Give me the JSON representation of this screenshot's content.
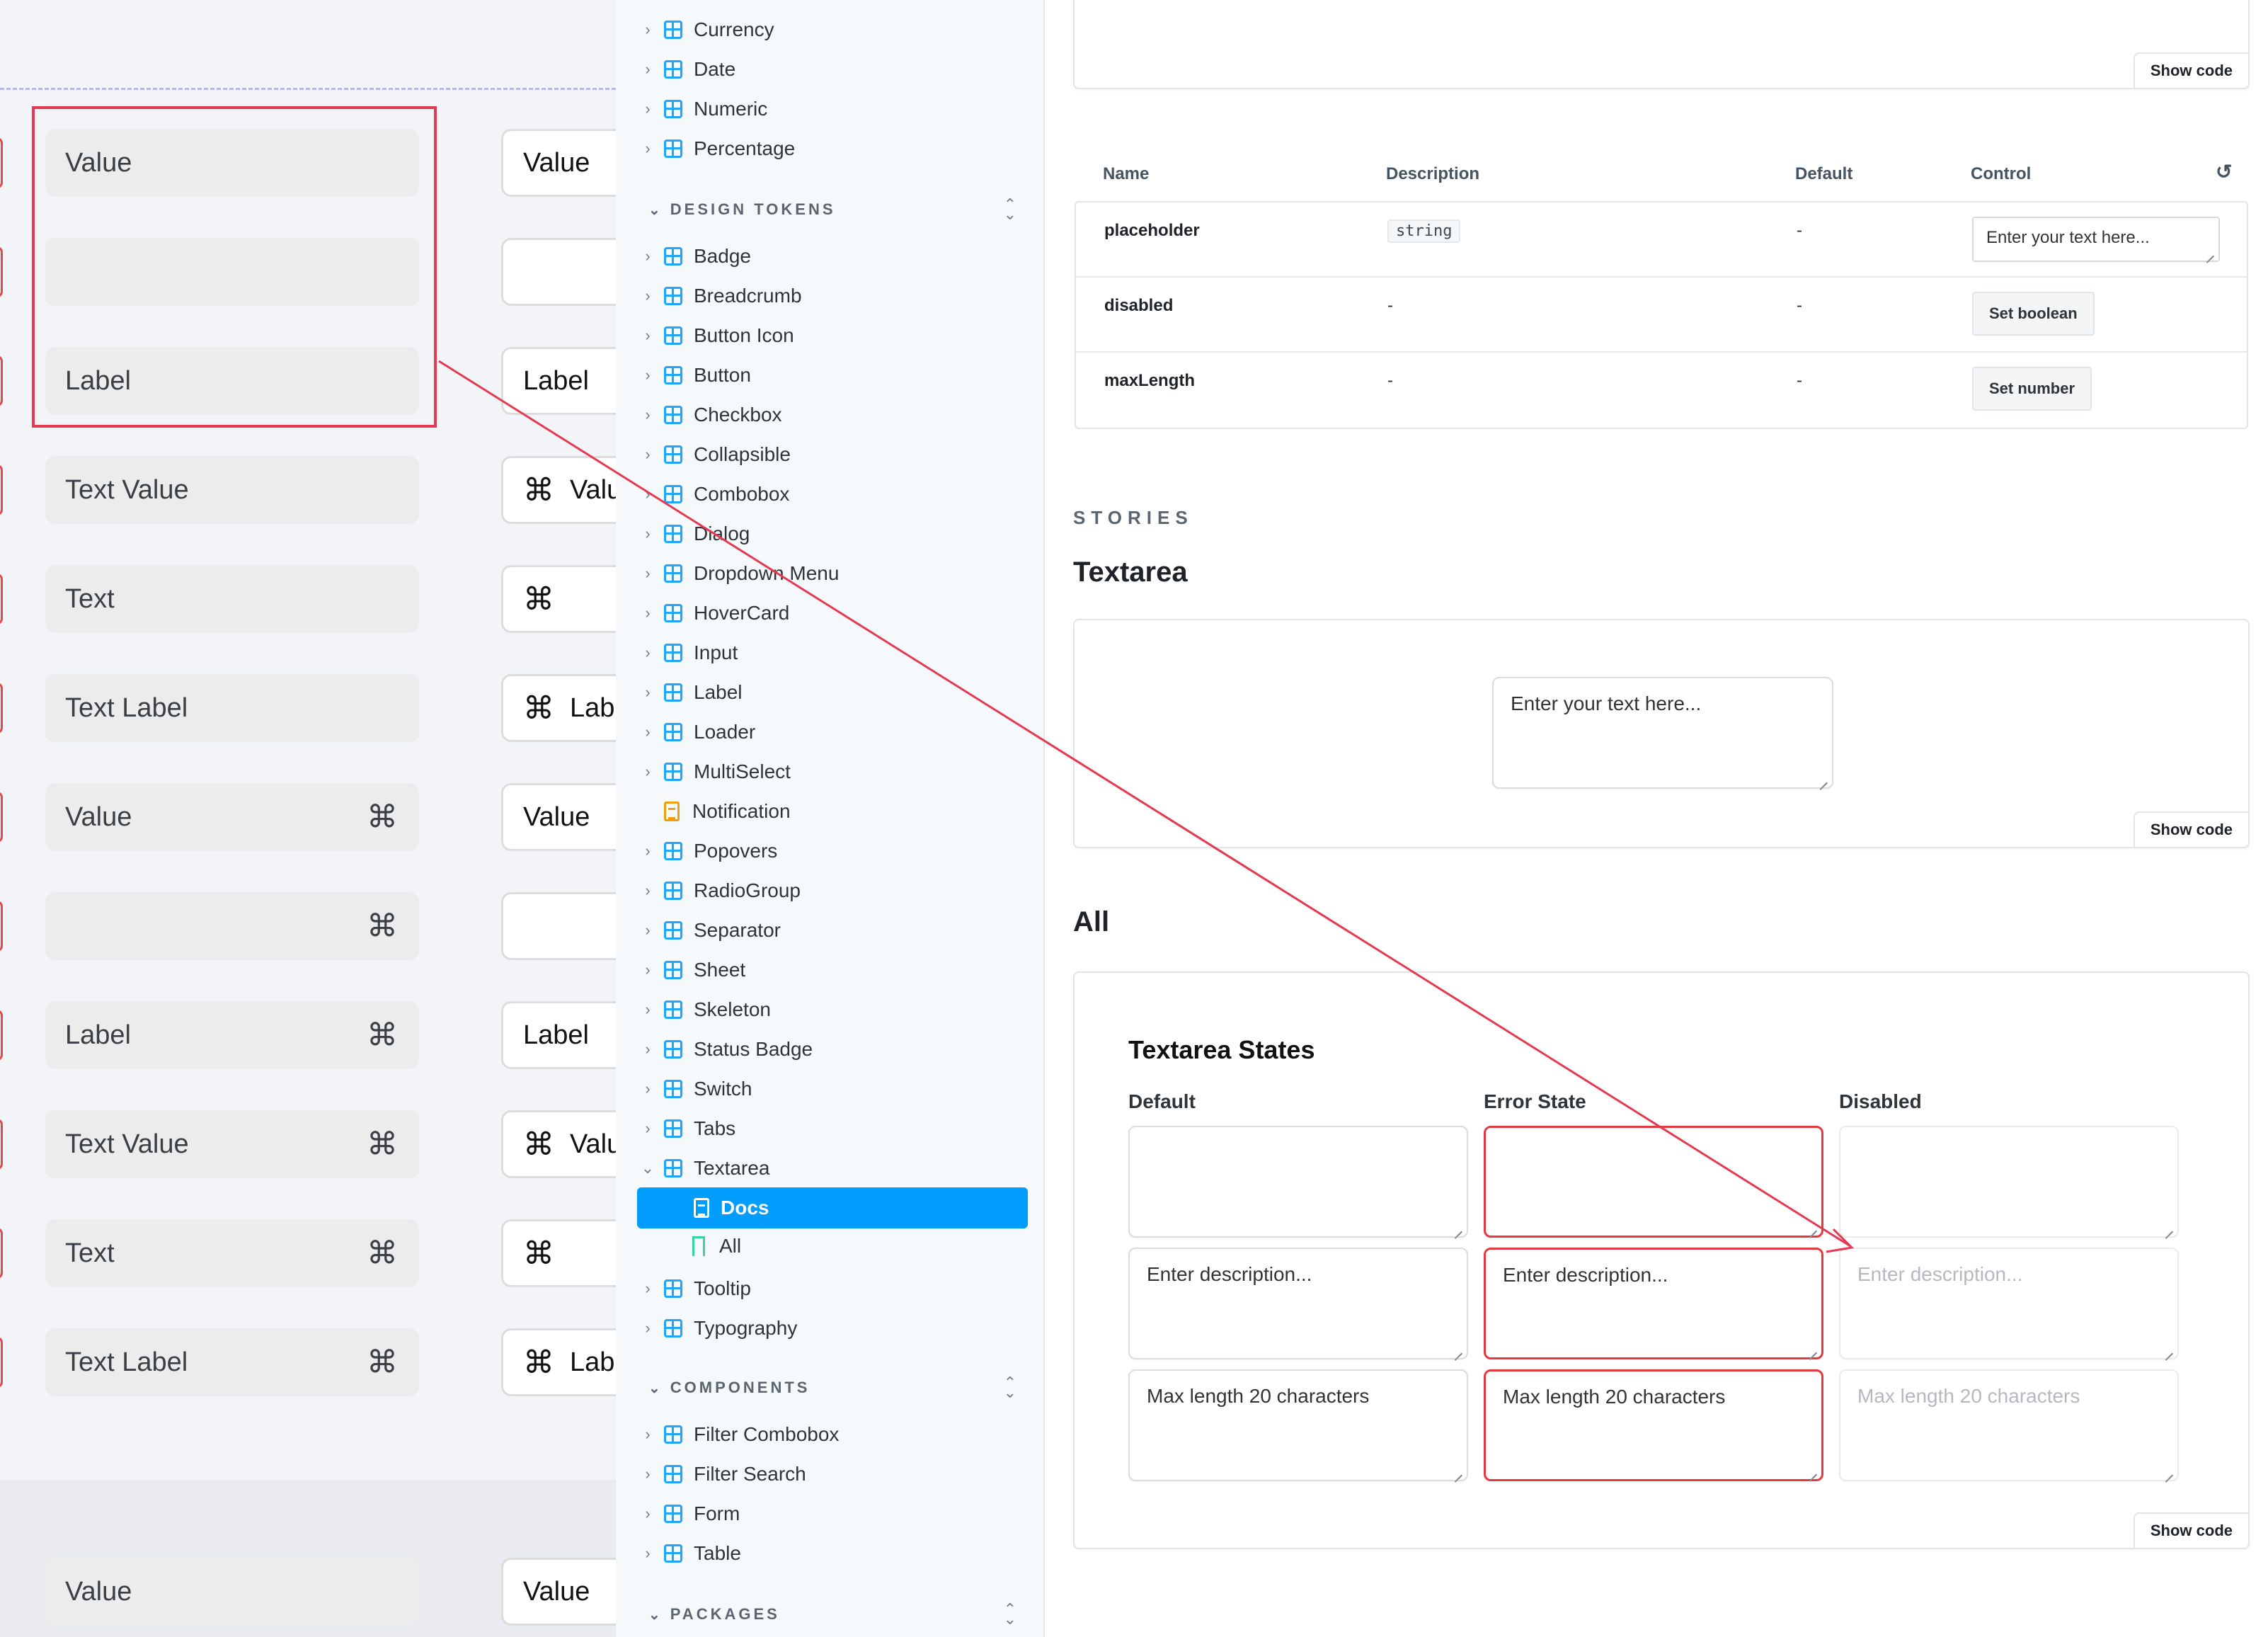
{
  "canvas": {
    "grey_fields": [
      {
        "text": "Value",
        "cmd": false
      },
      {
        "text": "",
        "cmd": false
      },
      {
        "text": "Label",
        "cmd": false
      },
      {
        "text": "Text  Value",
        "cmd": false
      },
      {
        "text": "Text",
        "cmd": false
      },
      {
        "text": "Text  Label",
        "cmd": false
      },
      {
        "text": "Value",
        "cmd": true
      },
      {
        "text": "",
        "cmd": true
      },
      {
        "text": "Label",
        "cmd": true
      },
      {
        "text": "Text  Value",
        "cmd": true
      },
      {
        "text": "Text",
        "cmd": true
      },
      {
        "text": "Text  Label",
        "cmd": true
      }
    ],
    "white_fields": [
      {
        "lead": "",
        "text": "Value"
      },
      {
        "lead": "",
        "text": ""
      },
      {
        "lead": "",
        "text": "Label"
      },
      {
        "lead": "⌘",
        "text": "Valu"
      },
      {
        "lead": "⌘",
        "text": ""
      },
      {
        "lead": "⌘",
        "text": "Lab"
      },
      {
        "lead": "",
        "text": "Value"
      },
      {
        "lead": "",
        "text": ""
      },
      {
        "lead": "",
        "text": "Label"
      },
      {
        "lead": "⌘",
        "text": "Valu"
      },
      {
        "lead": "⌘",
        "text": ""
      },
      {
        "lead": "⌘",
        "text": "Lab"
      }
    ],
    "bottom_grey": "Value",
    "bottom_white": "Value",
    "cmd_glyph": "⌘",
    "selection_color": "#e53952"
  },
  "sidebar": {
    "top_items": [
      "Currency",
      "Date",
      "Numeric",
      "Percentage"
    ],
    "design_tokens_label": "DESIGN TOKENS",
    "design_tokens": [
      "Badge",
      "Breadcrumb",
      "Button Icon",
      "Button",
      "Checkbox",
      "Collapsible",
      "Combobox",
      "Dialog",
      "Dropdown Menu",
      "HoverCard",
      "Input",
      "Label",
      "Loader",
      "MultiSelect",
      "Notification",
      "Popovers",
      "RadioGroup",
      "Separator",
      "Sheet",
      "Skeleton",
      "Status Badge",
      "Switch",
      "Tabs",
      "Textarea"
    ],
    "textarea_children": {
      "docs": "Docs",
      "all": "All"
    },
    "after_items": [
      "Tooltip",
      "Typography"
    ],
    "components_label": "COMPONENTS",
    "components": [
      "Filter Combobox",
      "Filter Search",
      "Form",
      "Table"
    ],
    "packages_label": "PACKAGES",
    "accent": "#029cfd"
  },
  "main": {
    "show_code": "Show code",
    "args": {
      "headers": {
        "name": "Name",
        "description": "Description",
        "default": "Default",
        "control": "Control"
      },
      "rows": [
        {
          "name": "placeholder",
          "description": "string",
          "default": "-",
          "control_type": "input",
          "control": "Enter your text here..."
        },
        {
          "name": "disabled",
          "description": "-",
          "default": "-",
          "control_type": "button",
          "control": "Set boolean"
        },
        {
          "name": "maxLength",
          "description": "-",
          "default": "-",
          "control_type": "button",
          "control": "Set number"
        }
      ]
    },
    "stories_label": "STORIES",
    "story_title": "Textarea",
    "story_placeholder": "Enter your text here...",
    "all_title": "All",
    "states_title": "Textarea States",
    "columns": [
      "Default",
      "Error State",
      "Disabled"
    ],
    "textareas": [
      "",
      "Enter description...",
      "Max length 20 characters"
    ],
    "error_color": "#e5393f"
  }
}
